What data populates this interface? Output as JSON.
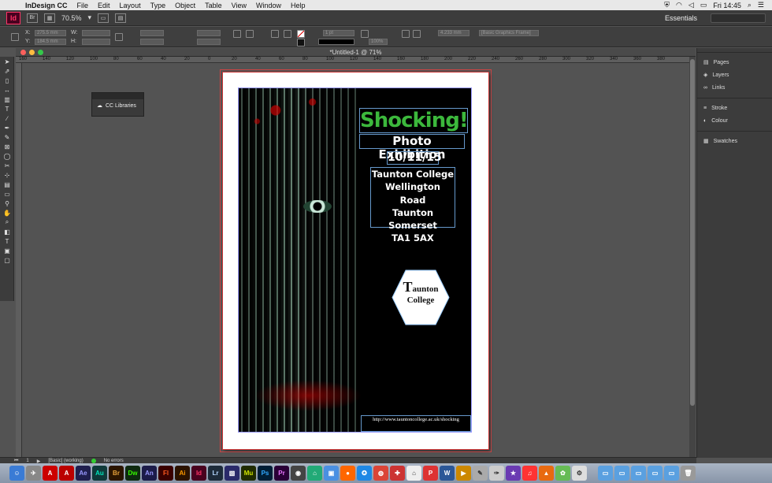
{
  "menubar": {
    "app_name": "InDesign CC",
    "items": [
      "File",
      "Edit",
      "Layout",
      "Type",
      "Object",
      "Table",
      "View",
      "Window",
      "Help"
    ],
    "clock": "Fri 14:45"
  },
  "appbar": {
    "logo": "Id",
    "zoom": "70.5%",
    "workspace": "Essentials"
  },
  "control": {
    "x_label": "X:",
    "y_label": "Y:",
    "w_label": "W:",
    "h_label": "H:",
    "x_value": "275.5 mm",
    "y_value": "184.5 mm",
    "stroke_weight": "1 pt",
    "scale": "100%",
    "offset": "4.233 mm",
    "frame_style": "[Basic Graphics Frame]"
  },
  "document": {
    "tab_title": "*Untitled-1 @ 71%",
    "ruler_marks": [
      "160",
      "140",
      "120",
      "100",
      "80",
      "60",
      "40",
      "20",
      "0",
      "20",
      "40",
      "60",
      "80",
      "100",
      "120",
      "140",
      "160",
      "180",
      "200",
      "220",
      "240",
      "260",
      "280",
      "300",
      "320",
      "340",
      "360",
      "380"
    ]
  },
  "poster": {
    "title": "Shocking!",
    "subtitle": "Photo Exhibition",
    "date": "10/11/15",
    "address": [
      "Taunton College",
      "Wellington Road",
      "Taunton",
      "Somerset",
      "TA1 5AX"
    ],
    "logo_initial": "T",
    "logo_rest": "aunton",
    "logo_line2": "College",
    "url": "http://www.tauntoncollege.ac.uk/shocking",
    "title_color": "#3cb83c"
  },
  "cc_libraries": {
    "label": "CC Libraries"
  },
  "panels": {
    "group1": [
      "Pages",
      "Layers",
      "Links"
    ],
    "group2": [
      "Stroke",
      "Colour"
    ],
    "group3": [
      "Swatches"
    ]
  },
  "status": {
    "page": "1",
    "style": "[Basic] (working)",
    "errors": "No errors"
  },
  "dock": {
    "apps": [
      "Ae",
      "Au",
      "Br",
      "Dw",
      "An",
      "Fl",
      "Ai",
      "Id",
      "Lr",
      "Mu",
      "Ps",
      "Pr"
    ]
  }
}
